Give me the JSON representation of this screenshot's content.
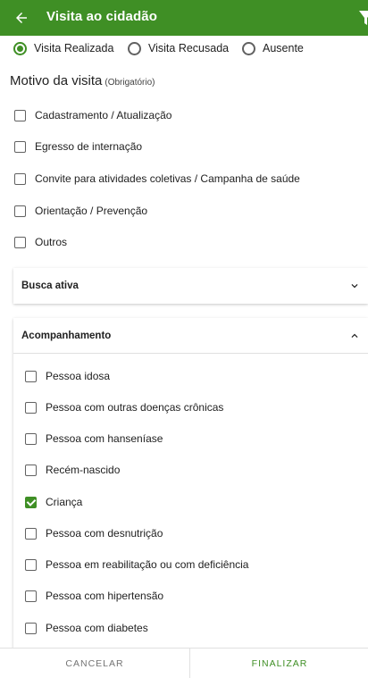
{
  "header": {
    "title": "Visita ao cidadão"
  },
  "visit_status": {
    "options": [
      "Visita Realizada",
      "Visita Recusada",
      "Ausente"
    ],
    "selected": "Visita Realizada"
  },
  "motivo": {
    "title": "Motivo da visita",
    "required_label": "(Obrigatório)",
    "items": [
      {
        "label": "Cadastramento / Atualização",
        "checked": false
      },
      {
        "label": "Egresso de internação",
        "checked": false
      },
      {
        "label": "Convite para atividades coletivas / Campanha de saúde",
        "checked": false
      },
      {
        "label": "Orientação / Prevenção",
        "checked": false
      },
      {
        "label": "Outros",
        "checked": false
      }
    ]
  },
  "busca_ativa": {
    "title": "Busca ativa",
    "expanded": false
  },
  "acompanhamento": {
    "title": "Acompanhamento",
    "expanded": true,
    "items": [
      {
        "label": "Pessoa idosa",
        "checked": false
      },
      {
        "label": "Pessoa com outras doenças crônicas",
        "checked": false
      },
      {
        "label": "Pessoa com hanseníase",
        "checked": false
      },
      {
        "label": "Recém-nascido",
        "checked": false
      },
      {
        "label": "Criança",
        "checked": true
      },
      {
        "label": "Pessoa com desnutrição",
        "checked": false
      },
      {
        "label": "Pessoa em reabilitação ou com deficiência",
        "checked": false
      },
      {
        "label": "Pessoa com hipertensão",
        "checked": false
      },
      {
        "label": "Pessoa com diabetes",
        "checked": false
      }
    ]
  },
  "footer": {
    "cancel_label": "CANCELAR",
    "finish_label": "FINALIZAR"
  },
  "colors": {
    "primary": "#3f8f25",
    "checkbox_border": "#616161"
  }
}
